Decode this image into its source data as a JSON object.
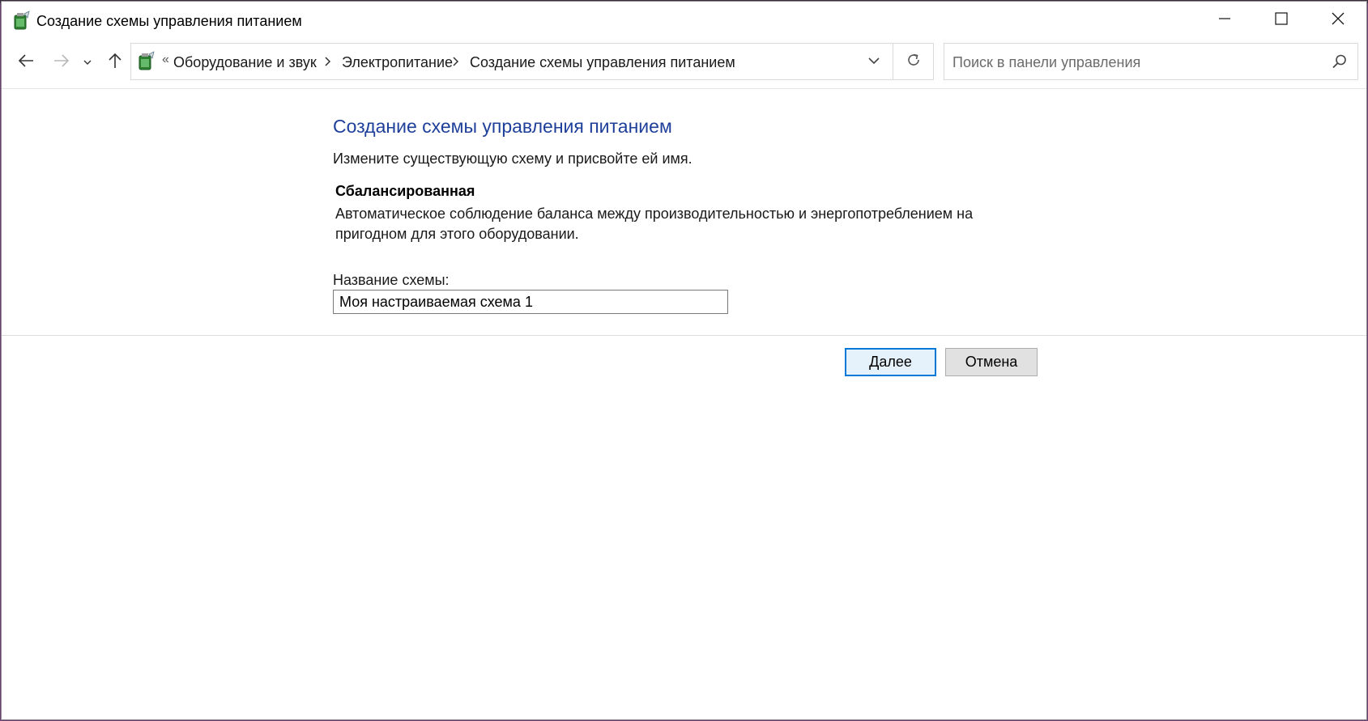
{
  "window": {
    "title": "Создание схемы управления питанием",
    "icon": "power-options-icon"
  },
  "titlebar": {
    "minimize_icon": "minimize-icon",
    "maximize_icon": "maximize-icon",
    "close_icon": "close-icon"
  },
  "nav": {
    "back_icon": "arrow-left-icon",
    "forward_icon": "arrow-right-icon",
    "recent_icon": "chevron-down-icon",
    "up_icon": "arrow-up-icon",
    "address": {
      "overflow": "«",
      "crumbs": [
        "Оборудование и звук",
        "Электропитание",
        "Создание схемы управления питанием"
      ]
    },
    "refresh_icon": "refresh-icon",
    "search": {
      "placeholder": "Поиск в панели управления",
      "value": ""
    }
  },
  "main": {
    "title": "Создание схемы управления питанием",
    "subtitle": "Измените существующую схему и присвойте ей имя.",
    "plan": {
      "name": "Сбалансированная",
      "description_line1": "Автоматическое соблюдение баланса между производительностью и энергопотреблением на",
      "description_line2": "пригодном для этого оборудовании."
    },
    "field": {
      "label": "Название схемы:",
      "value": "Моя настраиваемая схема 1"
    },
    "buttons": {
      "next": "Далее",
      "cancel": "Отмена"
    }
  },
  "colors": {
    "title_blue": "#1e3f9a",
    "accent": "#0078d7",
    "desktop": "#6b3f73"
  }
}
